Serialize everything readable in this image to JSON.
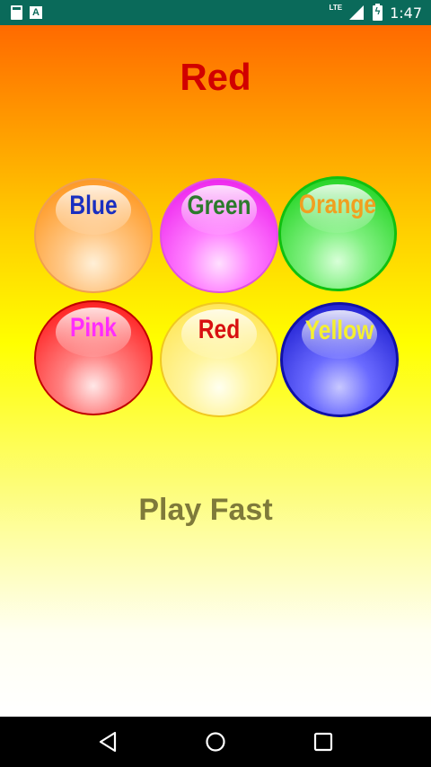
{
  "status_bar": {
    "network_label": "LTE",
    "time": "1:47",
    "icons": [
      "sd-card-icon",
      "text-a-icon",
      "signal-icon",
      "battery-icon"
    ]
  },
  "game": {
    "target_word": "Red",
    "target_color": "#d10000",
    "balls": [
      {
        "label": "Blue",
        "text_color": "#1a2fc0",
        "ball_color": "orange"
      },
      {
        "label": "Green",
        "text_color": "#2c7a2c",
        "ball_color": "magenta"
      },
      {
        "label": "Orange",
        "text_color": "#f0a020",
        "ball_color": "green"
      },
      {
        "label": "Pink",
        "text_color": "#ff2cff",
        "ball_color": "red"
      },
      {
        "label": "Red",
        "text_color": "#d81010",
        "ball_color": "light-yellow"
      },
      {
        "label": "Yellow",
        "text_color": "#f5f030",
        "ball_color": "blue"
      }
    ],
    "play_fast_label": "Play Fast"
  },
  "nav_bar": {
    "buttons": [
      "back-icon",
      "home-icon",
      "recents-icon"
    ]
  }
}
